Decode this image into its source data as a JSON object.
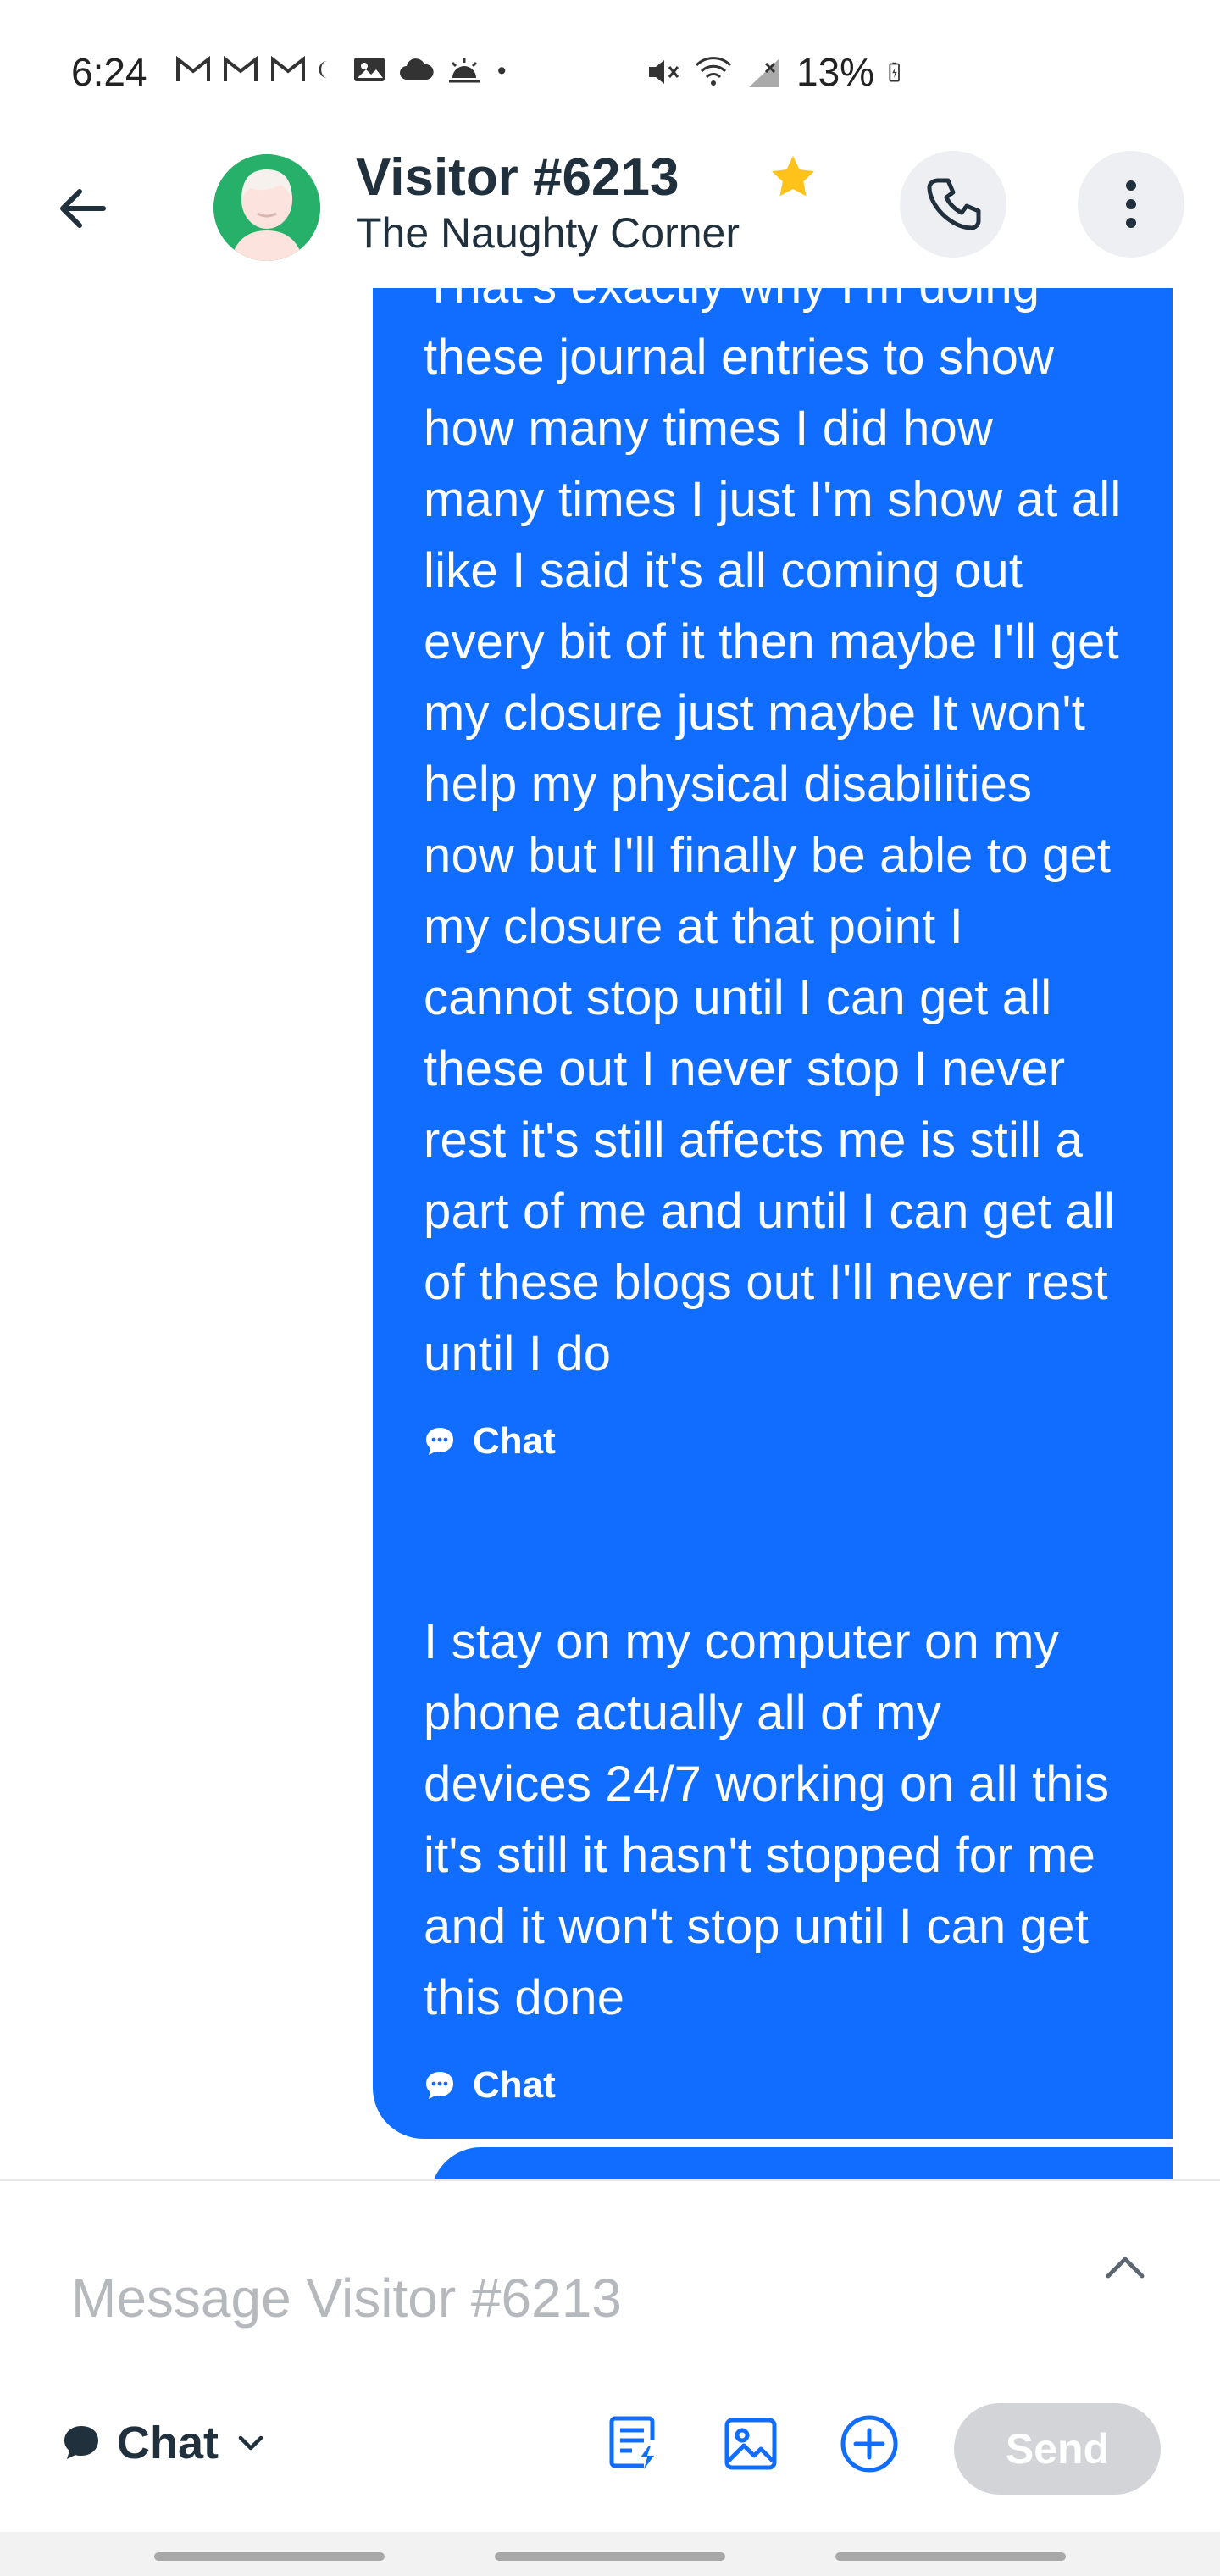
{
  "status_bar": {
    "time": "6:24",
    "battery": "13%",
    "icons": [
      "gmail-icon",
      "gmail-icon",
      "gmail-icon",
      "moon-icon",
      "photo-icon",
      "cloud-icon",
      "sunrise-icon",
      "dot-icon",
      "mute-icon",
      "wifi-icon",
      "signal-icon",
      "battery-charging-icon"
    ]
  },
  "header": {
    "visitor_name": "Visitor #6213",
    "site_name": "The Naughty Corner",
    "starred": true,
    "colors": {
      "avatar_bg": "#27b06a",
      "star": "#ffc21a"
    }
  },
  "messages": [
    {
      "text": "That's exactly why I'm doing these journal entries to show how many times I did how many times I just I'm show at all like I said it's all coming out every bit of it then maybe I'll get my closure just maybe It won't help my physical disabilities now but I'll finally be able to get my closure at that point I cannot stop until I can get all these out I never stop I never rest it's still affects me is still a part of me and until I can get all of these blogs out I'll never rest until I do",
      "channel": "Chat"
    },
    {
      "text": "I stay on my computer on my phone actually all of my devices 24/7 working on all this it's still it hasn't stopped for me and it won't stop until I can get this done",
      "channel": "Chat"
    }
  ],
  "composer": {
    "placeholder": "Message Visitor #6213",
    "value": "",
    "channel_label": "Chat",
    "send_label": "Send",
    "tools": [
      "quick-reply-icon",
      "image-icon",
      "add-icon"
    ]
  },
  "colors": {
    "bubble": "#116dff",
    "accent": "#116dff",
    "send_disabled": "#d3d4d8",
    "text_dark": "#20303c"
  }
}
